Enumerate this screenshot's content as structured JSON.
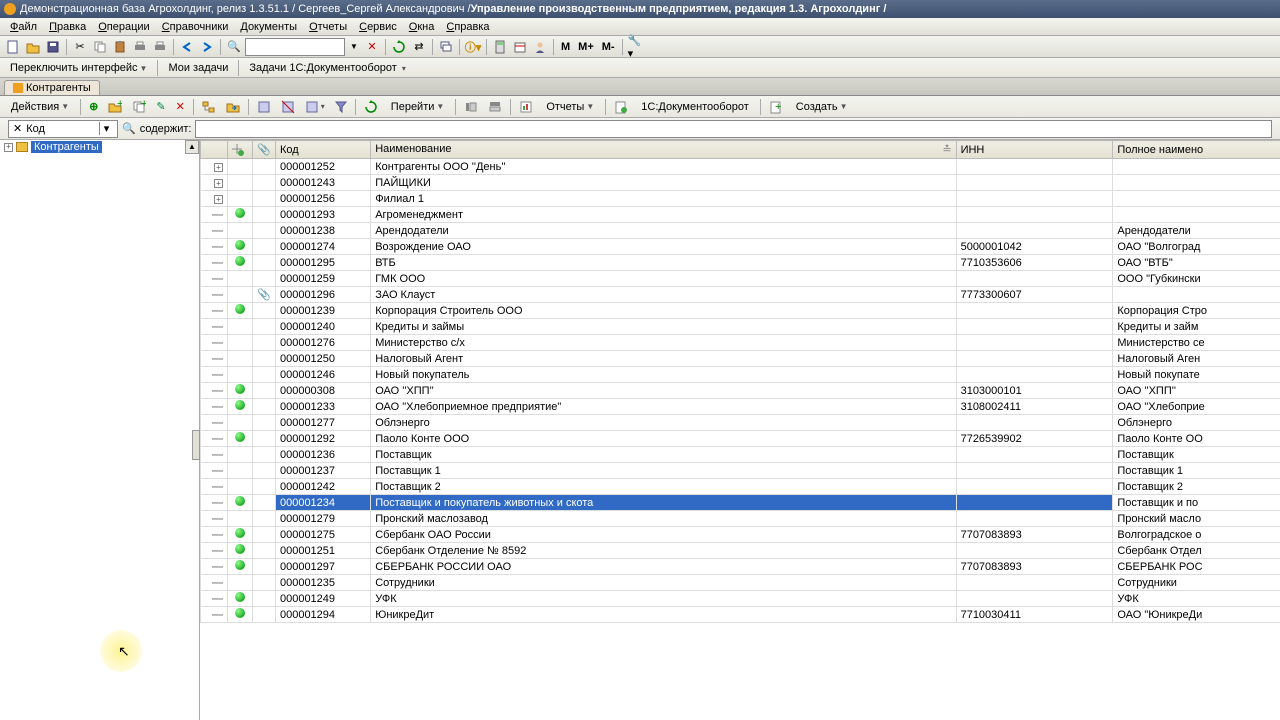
{
  "title": {
    "prefix": "Демонстрационная база Агрохолдинг, релиз 1.3.51.1 / Сергеев_Сергей Александрович /",
    "suffix": " Управление производственным предприятием, редакция 1.3. Агрохолдинг /"
  },
  "menu": [
    "Файл",
    "Правка",
    "Операции",
    "Справочники",
    "Документы",
    "Отчеты",
    "Сервис",
    "Окна",
    "Справка"
  ],
  "toolbar_calc": [
    "M",
    "M+",
    "M-"
  ],
  "second_bar": {
    "switch_interface": "Переключить интерфейс",
    "my_tasks": "Мои задачи",
    "tasks_1c": "Задачи 1С:Документооборот"
  },
  "tab": "Контрагенты",
  "action_bar": {
    "actions": "Действия",
    "go": "Перейти",
    "reports": "Отчеты",
    "doc_flow": "1С:Документооборот",
    "create": "Создать"
  },
  "filter": {
    "field": "Код",
    "label": "содержит:",
    "value": ""
  },
  "tree": {
    "root": "Контрагенты"
  },
  "columns": {
    "code": "Код",
    "name": "Наименование",
    "inn": "ИНН",
    "full": "Полное наимено"
  },
  "rows": [
    {
      "t": "f",
      "code": "000001252",
      "name": "Контрагенты ООО ''День''",
      "inn": "",
      "full": ""
    },
    {
      "t": "f",
      "code": "000001243",
      "name": "ПАЙЩИКИ",
      "inn": "",
      "full": ""
    },
    {
      "t": "f",
      "code": "000001256",
      "name": "Филиал 1",
      "inn": "",
      "full": ""
    },
    {
      "t": "i",
      "g": true,
      "code": "000001293",
      "name": "Агроменеджмент",
      "inn": "",
      "full": ""
    },
    {
      "t": "i",
      "code": "000001238",
      "name": "Арендодатели",
      "inn": "",
      "full": "Арендодатели"
    },
    {
      "t": "i",
      "g": true,
      "code": "000001274",
      "name": "Возрождение ОАО",
      "inn": "5000001042",
      "full": "ОАО \"Волгоград"
    },
    {
      "t": "i",
      "g": true,
      "code": "000001295",
      "name": "ВТБ",
      "inn": "7710353606",
      "full": "ОАО \"ВТБ\""
    },
    {
      "t": "i",
      "code": "000001259",
      "name": "ГМК ООО",
      "inn": "",
      "full": "ООО \"Губкински"
    },
    {
      "t": "i",
      "clip": true,
      "code": "000001296",
      "name": "ЗАО Клауст",
      "inn": "7773300607",
      "full": ""
    },
    {
      "t": "i",
      "g": true,
      "code": "000001239",
      "name": "Корпорация Строитель ООО",
      "inn": "",
      "full": "Корпорация Стро"
    },
    {
      "t": "i",
      "code": "000001240",
      "name": "Кредиты и займы",
      "inn": "",
      "full": "Кредиты и займ"
    },
    {
      "t": "i",
      "code": "000001276",
      "name": "Министерство с/х",
      "inn": "",
      "full": "Министерство се"
    },
    {
      "t": "i",
      "code": "000001250",
      "name": "Налоговый Агент",
      "inn": "",
      "full": "Налоговый Аген"
    },
    {
      "t": "i",
      "code": "000001246",
      "name": "Новый покупатель",
      "inn": "",
      "full": "Новый покупате"
    },
    {
      "t": "i",
      "g": true,
      "code": "000000308",
      "name": "ОАО ''ХПП''",
      "inn": "3103000101",
      "full": "ОАО ''ХПП''"
    },
    {
      "t": "i",
      "g": true,
      "code": "000001233",
      "name": "ОАО \"Хлебоприемное предприятие\"",
      "inn": "3108002411",
      "full": "ОАО \"Хлебоприе"
    },
    {
      "t": "i",
      "code": "000001277",
      "name": "Облэнерго",
      "inn": "",
      "full": "Облэнерго"
    },
    {
      "t": "i",
      "g": true,
      "code": "000001292",
      "name": "Паоло Конте ООО",
      "inn": "7726539902",
      "full": "Паоло Конте ОО"
    },
    {
      "t": "i",
      "code": "000001236",
      "name": "Поставщик",
      "inn": "",
      "full": "Поставщик"
    },
    {
      "t": "i",
      "code": "000001237",
      "name": "Поставщик 1",
      "inn": "",
      "full": "Поставщик 1"
    },
    {
      "t": "i",
      "code": "000001242",
      "name": "Поставщик 2",
      "inn": "",
      "full": "Поставщик 2"
    },
    {
      "t": "i",
      "g": true,
      "sel": true,
      "code": "000001234",
      "name": "Поставщик и покупатель животных и скота",
      "inn": "",
      "full": "Поставщик и по"
    },
    {
      "t": "i",
      "code": "000001279",
      "name": "Пронский маслозавод",
      "inn": "",
      "full": "Пронский масло"
    },
    {
      "t": "i",
      "g": true,
      "code": "000001275",
      "name": "Сбербанк  ОАО России",
      "inn": "7707083893",
      "full": "Волгоградское о"
    },
    {
      "t": "i",
      "g": true,
      "code": "000001251",
      "name": "Сбербанк Отделение № 8592",
      "inn": "",
      "full": "Сбербанк Отдел"
    },
    {
      "t": "i",
      "g": true,
      "code": "000001297",
      "name": "СБЕРБАНК РОССИИ ОАО",
      "inn": "7707083893",
      "full": "СБЕРБАНК РОС"
    },
    {
      "t": "i",
      "code": "000001235",
      "name": "Сотрудники",
      "inn": "",
      "full": "Сотрудники"
    },
    {
      "t": "i",
      "g": true,
      "code": "000001249",
      "name": "УФК",
      "inn": "",
      "full": "УФК"
    },
    {
      "t": "i",
      "g": true,
      "code": "000001294",
      "name": "ЮникреДит",
      "inn": "7710030411",
      "full": "ОАО \"ЮникреДи"
    }
  ]
}
